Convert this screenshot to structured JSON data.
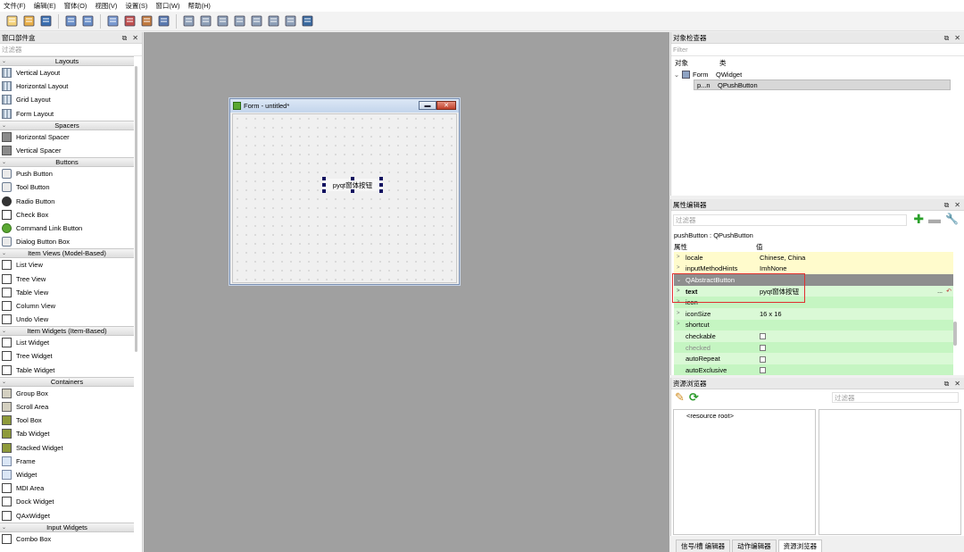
{
  "menu": [
    "文件(F)",
    "编辑(E)",
    "窗体(O)",
    "视图(V)",
    "设置(S)",
    "窗口(W)",
    "帮助(H)"
  ],
  "toolbar_icons": [
    "new-file-icon",
    "open-folder-icon",
    "save-icon",
    "cascade-windows-icon",
    "tile-windows-icon",
    "edit-widgets-icon",
    "edit-signals-slots-icon",
    "edit-buddies-icon",
    "edit-tab-order-icon",
    "layout-horizontal-icon",
    "layout-vertical-icon",
    "layout-horizontal-splitter-icon",
    "layout-vertical-splitter-icon",
    "layout-grid-icon",
    "layout-form-icon",
    "break-layout-icon",
    "adjust-size-icon"
  ],
  "widget_box": {
    "title": "窗口部件盒",
    "filter_placeholder": "过滤器",
    "categories": [
      {
        "name": "Layouts",
        "items": [
          "Vertical Layout",
          "Horizontal Layout",
          "Grid Layout",
          "Form Layout"
        ],
        "icons": [
          "lay",
          "lay",
          "lay",
          "lay"
        ]
      },
      {
        "name": "Spacers",
        "items": [
          "Horizontal Spacer",
          "Vertical Spacer"
        ],
        "icons": [
          "spc",
          "spc"
        ]
      },
      {
        "name": "Buttons",
        "items": [
          "Push Button",
          "Tool Button",
          "Radio Button",
          "Check Box",
          "Command Link Button",
          "Dialog Button Box"
        ],
        "icons": [
          "btn",
          "btn",
          "radio",
          "check",
          "green",
          "btn"
        ]
      },
      {
        "name": "Item Views (Model-Based)",
        "items": [
          "List View",
          "Tree View",
          "Table View",
          "Column View",
          "Undo View"
        ],
        "icons": [
          "view",
          "view",
          "view",
          "view",
          "view"
        ]
      },
      {
        "name": "Item Widgets (Item-Based)",
        "items": [
          "List Widget",
          "Tree Widget",
          "Table Widget"
        ],
        "icons": [
          "view",
          "view",
          "view"
        ]
      },
      {
        "name": "Containers",
        "items": [
          "Group Box",
          "Scroll Area",
          "Tool Box",
          "Tab Widget",
          "Stacked Widget",
          "Frame",
          "Widget",
          "MDI Area",
          "Dock Widget",
          "QAxWidget"
        ],
        "icons": [
          "cont",
          "cont",
          "tool",
          "tool",
          "tool",
          "frame",
          "frame",
          "view",
          "view",
          "view"
        ]
      },
      {
        "name": "Input Widgets",
        "items": [
          "Combo Box"
        ],
        "icons": [
          "view"
        ]
      }
    ]
  },
  "form": {
    "title": "Form - untitled*",
    "min_label": "▬",
    "close_label": "✕",
    "button_text": "pyqt窗体按钮"
  },
  "object_inspector": {
    "title": "对象检查器",
    "filter_placeholder": "Filter",
    "col_object": "对象",
    "col_class": "类",
    "rows": [
      {
        "object": "Form",
        "class": "QWidget"
      },
      {
        "object": "p...n",
        "class": "QPushButton"
      }
    ]
  },
  "property_editor": {
    "title": "属性编辑器",
    "filter_placeholder": "过滤器",
    "class_line": "pushButton : QPushButton",
    "col_property": "属性",
    "col_value": "值",
    "rows": [
      {
        "name": "locale",
        "value": "Chinese, China",
        "style": "yellow",
        "exp": true
      },
      {
        "name": "inputMethodHints",
        "value": "ImhNone",
        "style": "yellow",
        "exp": true
      },
      {
        "name": "QAbstractButton",
        "value": "",
        "style": "gray",
        "exp": false
      },
      {
        "name": "text",
        "value": "pyqt窗体按钮",
        "style": "lgreen",
        "exp": true,
        "bold": true
      },
      {
        "name": "icon",
        "value": "",
        "style": "green",
        "exp": true
      },
      {
        "name": "iconSize",
        "value": "16 x 16",
        "style": "lgreen",
        "exp": true
      },
      {
        "name": "shortcut",
        "value": "",
        "style": "green",
        "exp": true
      },
      {
        "name": "checkable",
        "value": "",
        "style": "lgreen",
        "check": true
      },
      {
        "name": "checked",
        "value": "",
        "style": "green",
        "check": true,
        "dim": true
      },
      {
        "name": "autoRepeat",
        "value": "",
        "style": "lgreen",
        "check": true
      },
      {
        "name": "autoExclusive",
        "value": "",
        "style": "green",
        "check": true
      }
    ]
  },
  "resource_browser": {
    "title": "资源浏览器",
    "filter_placeholder": "过滤器",
    "root": "<resource root>"
  },
  "bottom_tabs": [
    "信号/槽 编辑器",
    "动作编辑器",
    "资源浏览器"
  ],
  "colors": {
    "canvas": "#a0a0a0",
    "prop_yellow": "#fffbcc",
    "prop_green": "#c5f5c2",
    "highlight_red": "#e03030"
  }
}
